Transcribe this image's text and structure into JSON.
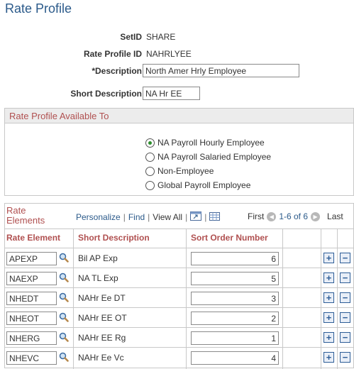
{
  "page": {
    "title": "Rate Profile"
  },
  "fields": {
    "setid_label": "SetID",
    "setid_value": "SHARE",
    "rate_profile_id_label": "Rate Profile ID",
    "rate_profile_id_value": "NAHRLYEE",
    "description_label": "*Description",
    "description_value": "North Amer Hrly Employee",
    "short_description_label": "Short Description",
    "short_description_value": "NA Hr EE"
  },
  "available_to": {
    "title": "Rate Profile Available To",
    "selected_index": 0,
    "options": [
      "NA Payroll Hourly Employee",
      "NA Payroll Salaried Employee",
      "Non-Employee",
      "Global Payroll Employee"
    ]
  },
  "grid": {
    "title_line1": "Rate",
    "title_line2": "Elements",
    "personalize": "Personalize",
    "find": "Find",
    "view_all": "View All",
    "first": "First",
    "range": "1-6 of 6",
    "last": "Last",
    "columns": {
      "rate_element": "Rate Element",
      "short_description": "Short Description",
      "sort_order": "Sort Order Number"
    },
    "rows": [
      {
        "rate_element": "APEXP",
        "short_description": "Bil AP Exp",
        "sort_order": "6"
      },
      {
        "rate_element": "NAEXP",
        "short_description": "NA TL Exp",
        "sort_order": "5"
      },
      {
        "rate_element": "NHEDT",
        "short_description": "NAHr Ee DT",
        "sort_order": "3"
      },
      {
        "rate_element": "NHEOT",
        "short_description": "NAHr EE OT",
        "sort_order": "2"
      },
      {
        "rate_element": "NHERG",
        "short_description": "NAHr EE Rg",
        "sort_order": "1"
      },
      {
        "rate_element": "NHEVC",
        "short_description": "NAHr Ee Vc",
        "sort_order": "4"
      }
    ],
    "add_symbol": "+",
    "delete_symbol": "−"
  },
  "icons": {
    "lookup": "magnifier-icon",
    "zoom": "grid-zoom-icon",
    "download": "download-to-spreadsheet-icon",
    "prev": "previous-arrow-icon",
    "next": "next-arrow-icon",
    "add": "add-row-icon",
    "delete": "delete-row-icon"
  },
  "colors": {
    "title_blue": "#2b5a8a",
    "header_red": "#b05050",
    "radio_green": "#2d8f2d",
    "button_blue": "#2d5d97"
  }
}
